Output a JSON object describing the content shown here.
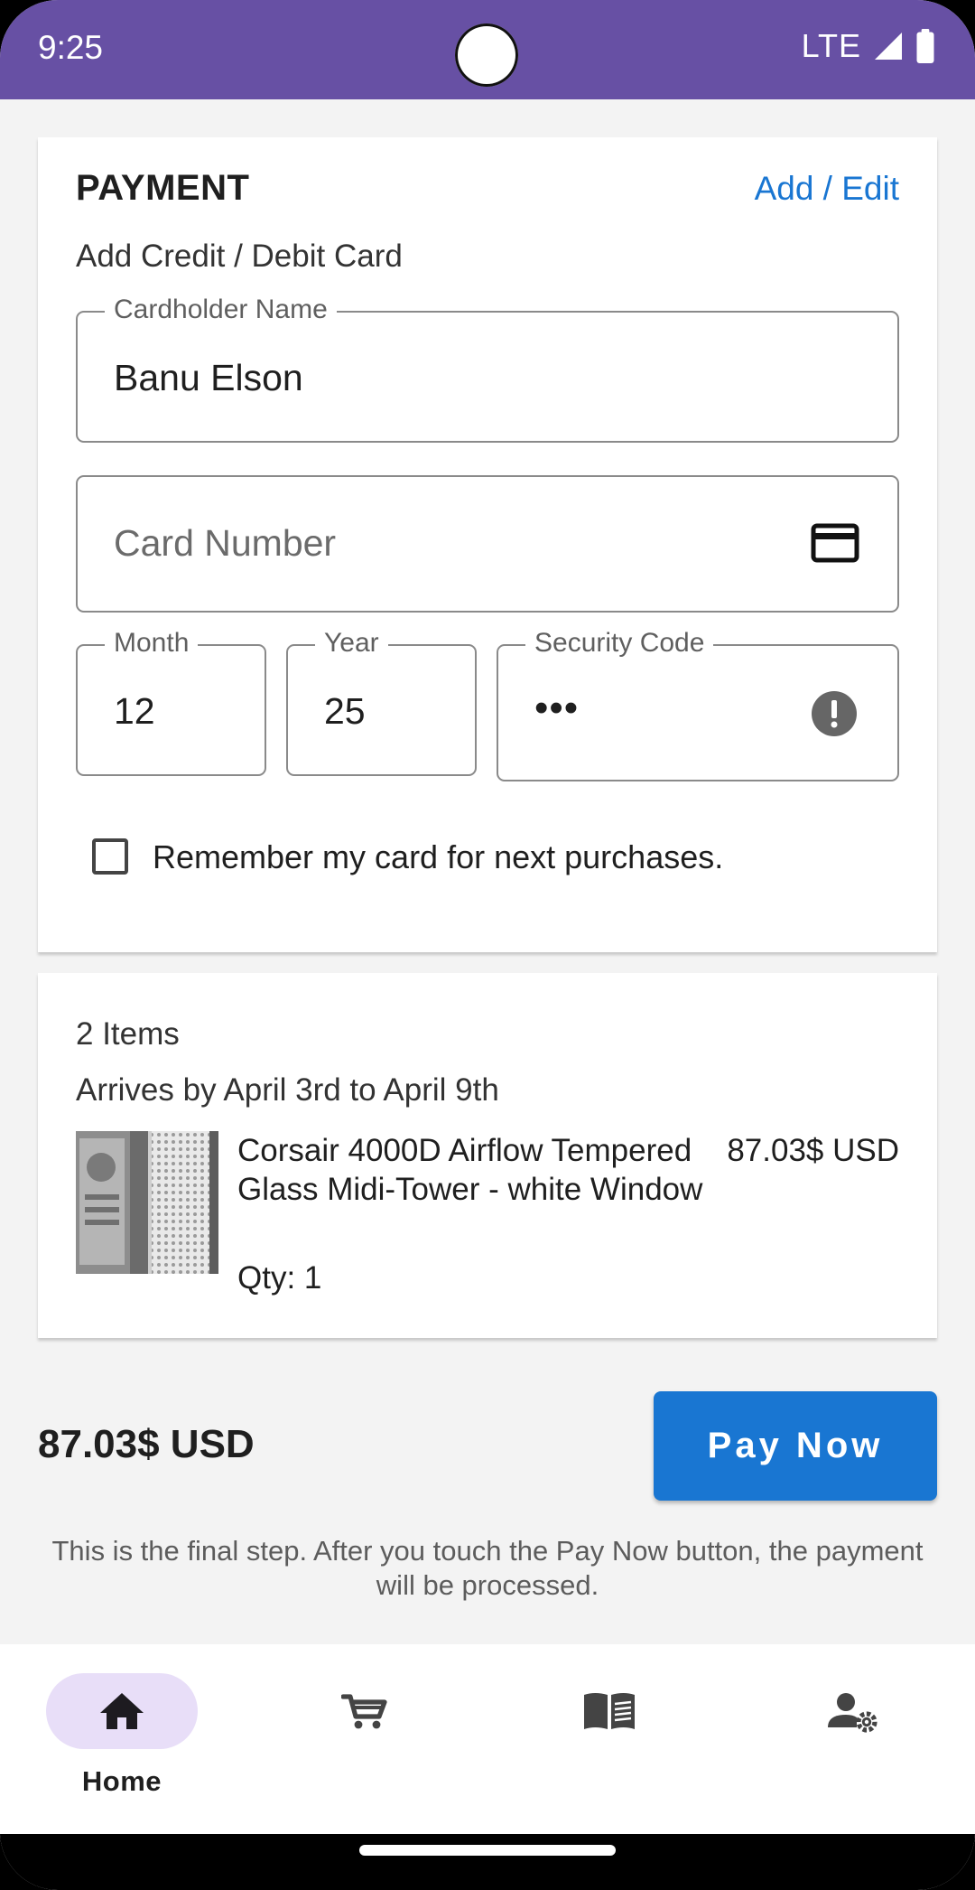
{
  "status_bar": {
    "time": "9:25",
    "network": "LTE",
    "background": "#6750a4"
  },
  "payment": {
    "title": "PAYMENT",
    "add_edit_link": "Add / Edit",
    "subtitle": "Add Credit / Debit Card",
    "cardholder": {
      "label": "Cardholder Name",
      "value": "Banu Elson"
    },
    "card_number": {
      "placeholder": "Card Number",
      "icon": "credit-card-icon"
    },
    "month": {
      "label": "Month",
      "value": "12"
    },
    "year": {
      "label": "Year",
      "value": "25"
    },
    "security_code": {
      "label": "Security Code",
      "value": "•••",
      "icon": "error-icon"
    },
    "remember": {
      "label": "Remember my card for next purchases.",
      "checked": false
    }
  },
  "order": {
    "items_count": "2 Items",
    "arrival": "Arrives by April 3rd to April 9th",
    "product": {
      "name": "Corsair 4000D Airflow Tempered Glass Midi-Tower - white Window",
      "price": "87.03$ USD",
      "qty": "Qty: 1"
    }
  },
  "checkout": {
    "total": "87.03$ USD",
    "pay_button": "Pay Now",
    "note": "This is the final step. After you touch the Pay Now button, the payment will be processed.",
    "accent": "#1976d2"
  },
  "bottom_nav": {
    "items": [
      {
        "label": "Home",
        "icon": "home-icon",
        "selected": true
      },
      {
        "label": "",
        "icon": "cart-icon",
        "selected": false
      },
      {
        "label": "",
        "icon": "book-icon",
        "selected": false
      },
      {
        "label": "",
        "icon": "account-settings-icon",
        "selected": false
      }
    ],
    "selected_pill_color": "#e8def8"
  }
}
